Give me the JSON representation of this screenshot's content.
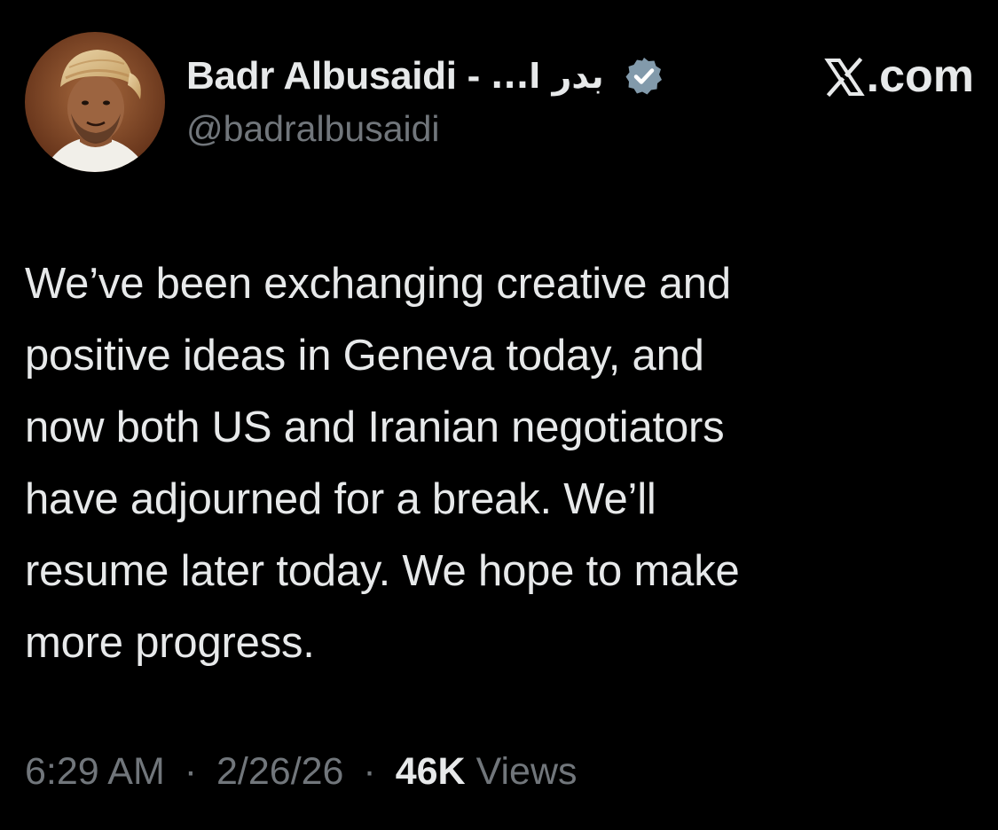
{
  "author": {
    "display_name": "Badr Albusaidi -",
    "arabic_name": "بدر ا...",
    "handle": "@badralbusaidi",
    "verified": true,
    "avatar": "profile-photo"
  },
  "source": {
    "label": ".com",
    "logo": "x-logo-icon"
  },
  "tweet": {
    "lines": [
      "We’ve been exchanging creative and",
      "positive ideas in Geneva today, and",
      "now both US and Iranian negotiators",
      "have adjourned for a break. We’ll",
      "resume later today. We hope to make",
      "more progress."
    ]
  },
  "meta": {
    "time": "6:29 AM",
    "separator": "·",
    "date": "2/26/26",
    "views_count": "46K",
    "views_label": "Views"
  },
  "colors": {
    "background": "#000000",
    "primary_text": "#e7e9ea",
    "secondary_text": "#71767b",
    "verified_badge": "#829aab"
  }
}
